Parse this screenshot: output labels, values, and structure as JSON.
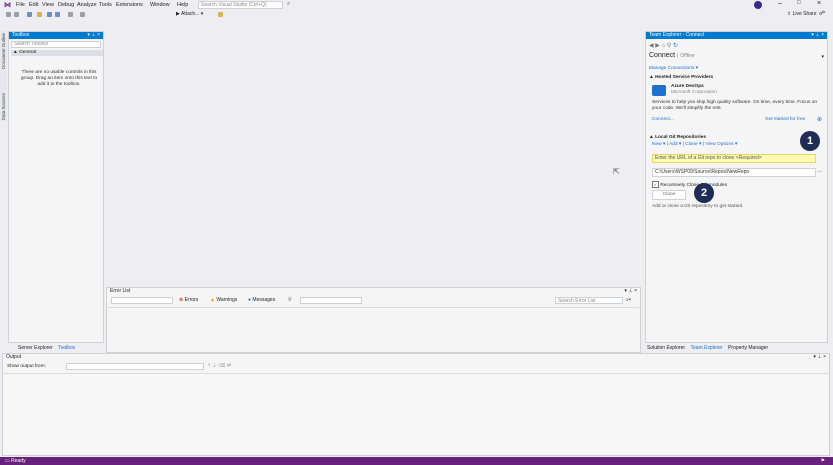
{
  "menu": [
    "File",
    "Edit",
    "View",
    "Debug",
    "Analyze",
    "Tools",
    "Extensions",
    "Window",
    "Help"
  ],
  "search_placeholder": "Search Visual Studio (Ctrl+Q)",
  "attach_label": "▶ Attach... ▾",
  "live_share": "Live Share",
  "left_vtabs": [
    "Document Outline",
    "Data Sources"
  ],
  "toolbox": {
    "title": "Toolbox",
    "search_placeholder": "Search Toolbox",
    "group": "▲ General",
    "empty_text": "There are no usable controls in this group. Drag an item onto this text to add it to the toolbox.",
    "bottom_tabs": [
      "Server Explorer",
      "Toolbox"
    ]
  },
  "error_list": {
    "title": "Error List",
    "errors": "Errors",
    "warnings": "Warnings",
    "messages": "Messages",
    "search_placeholder": "Search Error List"
  },
  "output": {
    "title": "Output",
    "show_from": "Show output from:"
  },
  "team_explorer": {
    "title": "Team Explorer - Connect",
    "heading": "Connect",
    "heading_sub": "Offline",
    "manage": "Manage Connections ▾",
    "hosted_header": "▲ Hosted Service Providers",
    "azure_title": "Azure DevOps",
    "azure_company": "Microsoft Corporation",
    "azure_desc": "Services to help you ship high quality software. On time, every time. Focus on your code. We'll simplify the rest.",
    "connect_link": "Connect...",
    "get_started": "Get started for free",
    "local_header": "▲ Local Git Repositories",
    "local_actions": "New ▾ | Add ▾ | Clone ▾ | View Options ▾",
    "url_placeholder": "Enter the URL of a Git repo to clone <Required>",
    "path_value": "C:\\Users\\WSP09\\Source\\Repos\\NewRepo",
    "recursive_label": "Recursively Clone Submodules",
    "clone_button": "Clone",
    "add_hint": "Add or clone a Git repository to get started.",
    "bottom_tabs": [
      "Solution Explorer",
      "Team Explorer",
      "Property Manager"
    ]
  },
  "markers": [
    "1",
    "2"
  ],
  "status": "Ready",
  "colors": {
    "accent": "#007acc",
    "status": "#68217a",
    "marker": "#1f2c55",
    "highlight": "#fffbb0"
  }
}
